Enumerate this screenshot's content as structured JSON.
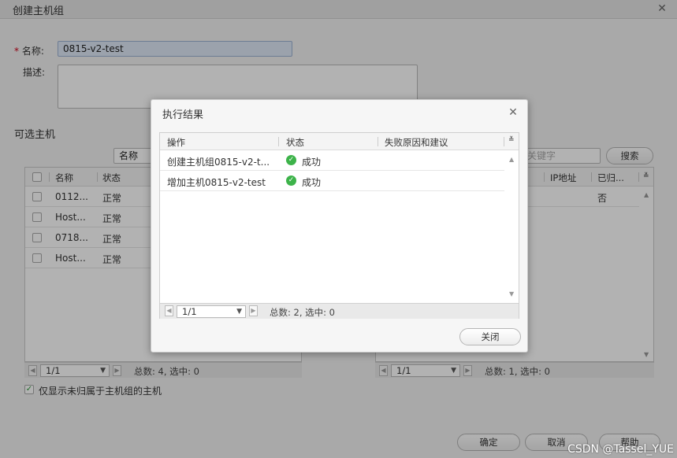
{
  "main": {
    "title": "创建主机组",
    "name_label": "名称:",
    "name_value": "0815-v2-test",
    "desc_label": "描述:",
    "available_hosts_title": "可选主机",
    "filter_label": "名称",
    "search_placeholder": "关键字",
    "search_button": "搜索",
    "left_grid": {
      "columns": [
        "名称",
        "状态"
      ],
      "rows": [
        {
          "name": "0112...",
          "status": "正常"
        },
        {
          "name": "Host...",
          "status": "正常"
        },
        {
          "name": "0718...",
          "status": "正常"
        },
        {
          "name": "Host...",
          "status": "正常"
        }
      ],
      "page": "1/1",
      "summary": "总数: 4, 选中: 0"
    },
    "right_grid": {
      "columns": [
        "IP地址",
        "已归..."
      ],
      "rows": [
        {
          "belongs": "否"
        }
      ],
      "page": "1/1",
      "summary": "总数: 1, 选中: 0"
    },
    "only_unassigned_label": "仅显示未归属于主机组的主机",
    "confirm_button": "确定",
    "cancel_button": "取消",
    "help_button": "帮助"
  },
  "modal": {
    "title": "执行结果",
    "columns": [
      "操作",
      "状态",
      "失败原因和建议"
    ],
    "rows": [
      {
        "operation": "创建主机组0815-v2-t...",
        "status": "成功",
        "reason": ""
      },
      {
        "operation": "增加主机0815-v2-test",
        "status": "成功",
        "reason": ""
      }
    ],
    "page": "1/1",
    "summary": "总数: 2, 选中: 0",
    "close_button": "关闭"
  },
  "watermark": "CSDN @Tassel_YUE",
  "colors": {
    "success": "#3db34a",
    "required": "#d0021b"
  }
}
